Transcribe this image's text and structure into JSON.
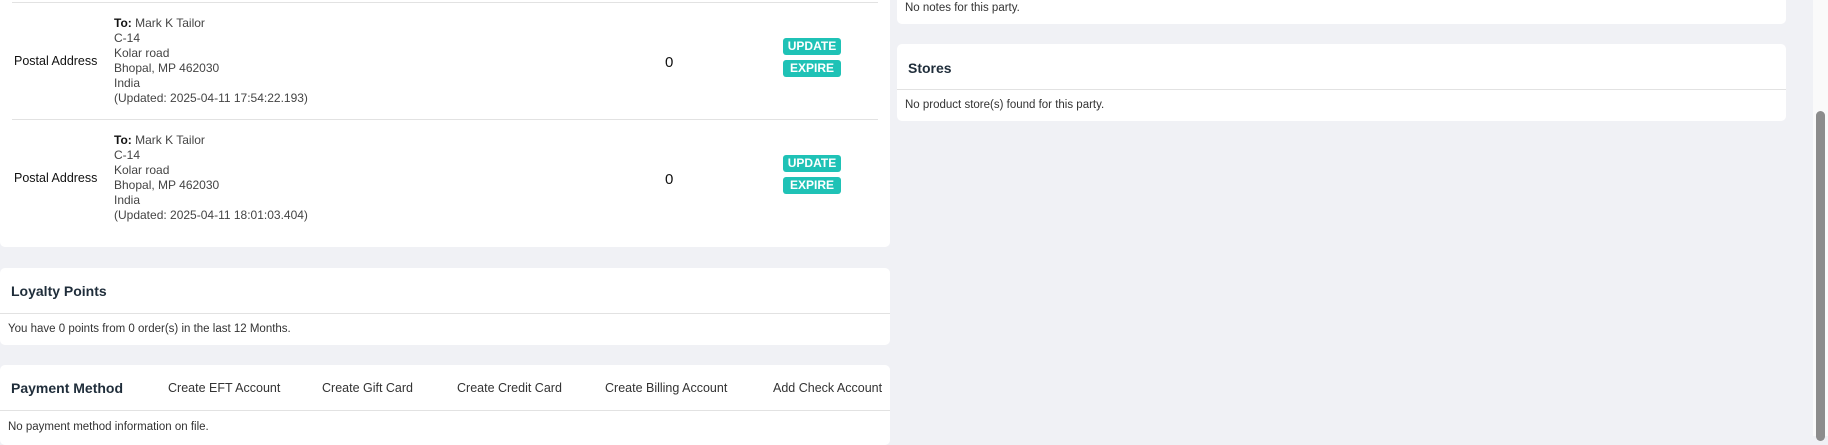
{
  "addresses": [
    {
      "label": "Postal Address",
      "to_label": "To:",
      "name": "Mark K Tailor",
      "line1": "C-14",
      "line2": "Kolar road",
      "city": "Bhopal, MP 462030",
      "country": "India",
      "updated": "(Updated: 2025-04-11 17:54:22.193)",
      "count": "0",
      "update": "UPDATE",
      "expire": "EXPIRE"
    },
    {
      "label": "Postal Address",
      "to_label": "To:",
      "name": "Mark K Tailor",
      "line1": "C-14",
      "line2": "Kolar road",
      "city": "Bhopal, MP 462030",
      "country": "India",
      "updated": "(Updated: 2025-04-11 18:01:03.404)",
      "count": "0",
      "update": "UPDATE",
      "expire": "EXPIRE"
    }
  ],
  "loyalty": {
    "title": "Loyalty Points",
    "text": "You have 0 points from 0 order(s) in the last 12 Months."
  },
  "payment": {
    "title": "Payment Method",
    "actions": [
      "Create EFT Account",
      "Create Gift Card",
      "Create Credit Card",
      "Create Billing Account",
      "Add Check Account"
    ],
    "text": "No payment method information on file."
  },
  "notes": {
    "text": "No notes for this party."
  },
  "stores": {
    "title": "Stores",
    "text": "No product store(s) found for this party."
  },
  "colors": {
    "accent": "#1fc2b6",
    "background": "#f0f1f5"
  }
}
